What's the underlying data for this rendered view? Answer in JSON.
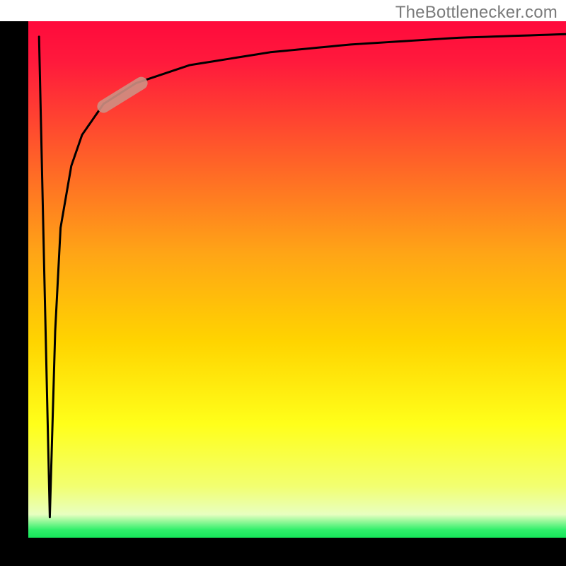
{
  "watermark": "TheBottlenecker.com",
  "chart_data": {
    "type": "line",
    "title": "",
    "xlabel": "",
    "ylabel": "",
    "xlim": [
      0,
      100
    ],
    "ylim": [
      0,
      100
    ],
    "note": "Axes have no tick labels; values are relative estimates read from plot geometry (0=bottom/left, 100=top/right).",
    "curve": {
      "description": "Curve starts near top-left, dives sharply down to near the bottom at a very small x, then rises steeply and asymptotes toward the top-right.",
      "points": [
        {
          "x": 2.0,
          "y": 97.0
        },
        {
          "x": 3.0,
          "y": 50.0
        },
        {
          "x": 4.0,
          "y": 4.0
        },
        {
          "x": 5.0,
          "y": 40.0
        },
        {
          "x": 6.0,
          "y": 60.0
        },
        {
          "x": 8.0,
          "y": 72.0
        },
        {
          "x": 10.0,
          "y": 78.0
        },
        {
          "x": 14.0,
          "y": 84.0
        },
        {
          "x": 20.0,
          "y": 88.0
        },
        {
          "x": 30.0,
          "y": 91.5
        },
        {
          "x": 45.0,
          "y": 94.0
        },
        {
          "x": 60.0,
          "y": 95.5
        },
        {
          "x": 80.0,
          "y": 96.8
        },
        {
          "x": 100.0,
          "y": 97.5
        }
      ]
    },
    "highlight_segment": {
      "description": "Thick rounded pinkish segment overlaid on the rising curve near the upper-left knee",
      "color": "#cf9083",
      "start": {
        "x": 14.0,
        "y": 83.5
      },
      "end": {
        "x": 21.0,
        "y": 88.0
      }
    },
    "background_gradient": {
      "stops": [
        {
          "offset": 0.0,
          "color": "#ff0a3c"
        },
        {
          "offset": 0.08,
          "color": "#ff1a3c"
        },
        {
          "offset": 0.25,
          "color": "#ff5a2a"
        },
        {
          "offset": 0.45,
          "color": "#ffa516"
        },
        {
          "offset": 0.62,
          "color": "#ffd400"
        },
        {
          "offset": 0.78,
          "color": "#ffff1a"
        },
        {
          "offset": 0.9,
          "color": "#f2ff70"
        },
        {
          "offset": 0.955,
          "color": "#e8ffc0"
        },
        {
          "offset": 0.985,
          "color": "#2fef6a"
        },
        {
          "offset": 1.0,
          "color": "#16e65a"
        }
      ]
    },
    "axes": {
      "color": "#000000",
      "x_axis": {
        "y": 0
      },
      "y_axis": {
        "x": 0
      },
      "thickness_px": 40
    }
  }
}
